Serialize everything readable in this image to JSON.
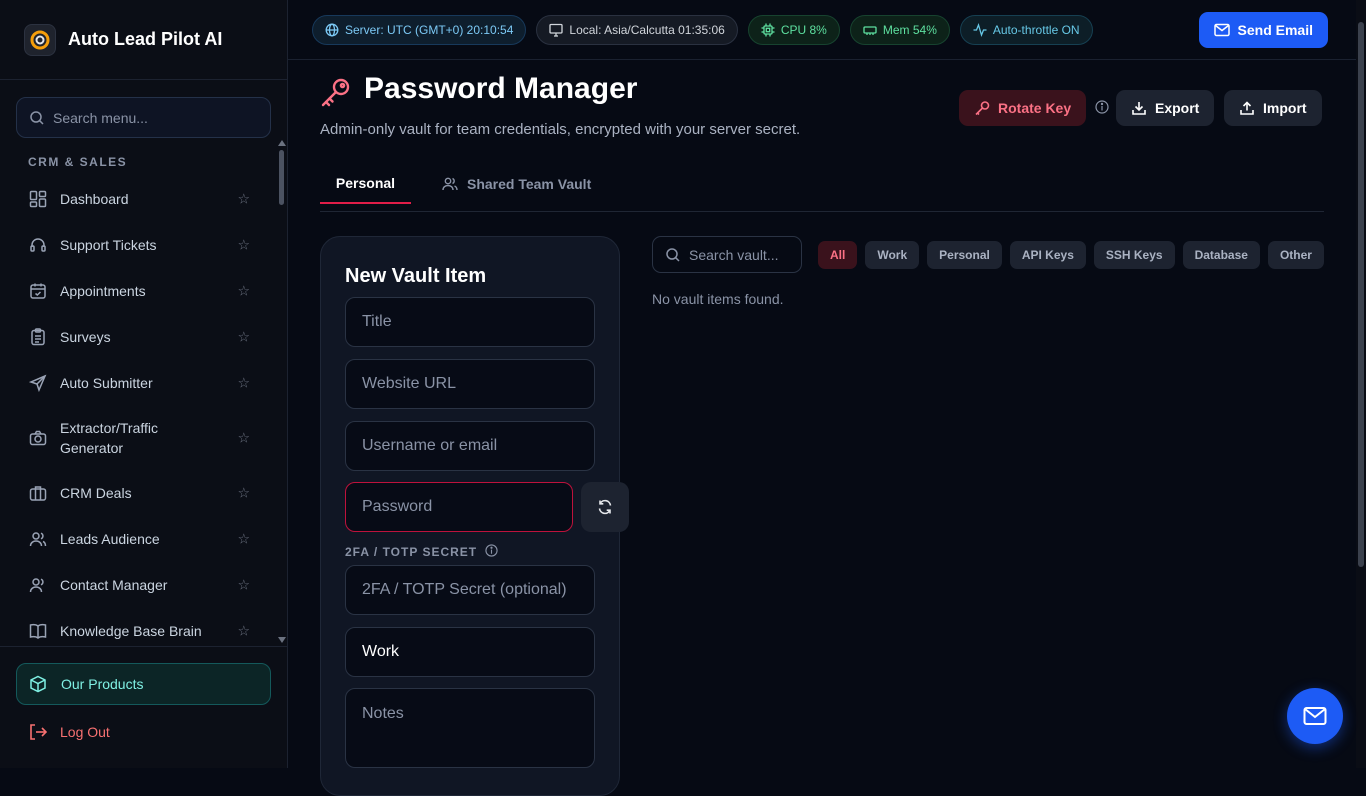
{
  "brand": {
    "name": "Auto Lead Pilot AI"
  },
  "sidebar": {
    "search_placeholder": "Search menu...",
    "section": "CRM & SALES",
    "items": [
      {
        "label": "Dashboard",
        "icon": "dashboard-icon"
      },
      {
        "label": "Support Tickets",
        "icon": "headset-icon"
      },
      {
        "label": "Appointments",
        "icon": "calendar-icon"
      },
      {
        "label": "Surveys",
        "icon": "clipboard-icon"
      },
      {
        "label": "Auto Submitter",
        "icon": "send-icon"
      },
      {
        "label": "Extractor/Traffic Generator",
        "icon": "camera-icon"
      },
      {
        "label": "CRM Deals",
        "icon": "briefcase-icon"
      },
      {
        "label": "Leads Audience",
        "icon": "users-icon"
      },
      {
        "label": "Contact Manager",
        "icon": "contacts-icon"
      },
      {
        "label": "Knowledge Base Brain",
        "icon": "book-icon"
      }
    ],
    "products": "Our Products",
    "logout": "Log Out"
  },
  "topbar": {
    "server": "Server: UTC (GMT+0) 20:10:54",
    "local": "Local: Asia/Calcutta 01:35:06",
    "cpu": "CPU 8%",
    "mem": "Mem 54%",
    "throttle": "Auto-throttle ON",
    "send": "Send Email"
  },
  "page": {
    "title": "Password Manager",
    "subtitle": "Admin-only vault for team credentials, encrypted with your server secret.",
    "rotate": "Rotate Key",
    "export": "Export",
    "import": "Import",
    "tabs": [
      "Personal",
      "Shared Team Vault"
    ]
  },
  "form": {
    "heading": "New Vault Item",
    "title_ph": "Title",
    "url_ph": "Website URL",
    "user_ph": "Username or email",
    "pw_ph": "Password",
    "totp_label": "2FA / TOTP SECRET",
    "totp_ph": "2FA / TOTP Secret (optional)",
    "category": "Work",
    "notes_ph": "Notes"
  },
  "vault": {
    "search_ph": "Search vault...",
    "filters": [
      "All",
      "Work",
      "Personal",
      "API Keys",
      "SSH Keys",
      "Database",
      "Other"
    ],
    "active_filter": "All",
    "empty": "No vault items found."
  },
  "colors": {
    "accent": "#1d5bf5",
    "danger": "#e11d48",
    "teal": "#7ff0e3"
  }
}
